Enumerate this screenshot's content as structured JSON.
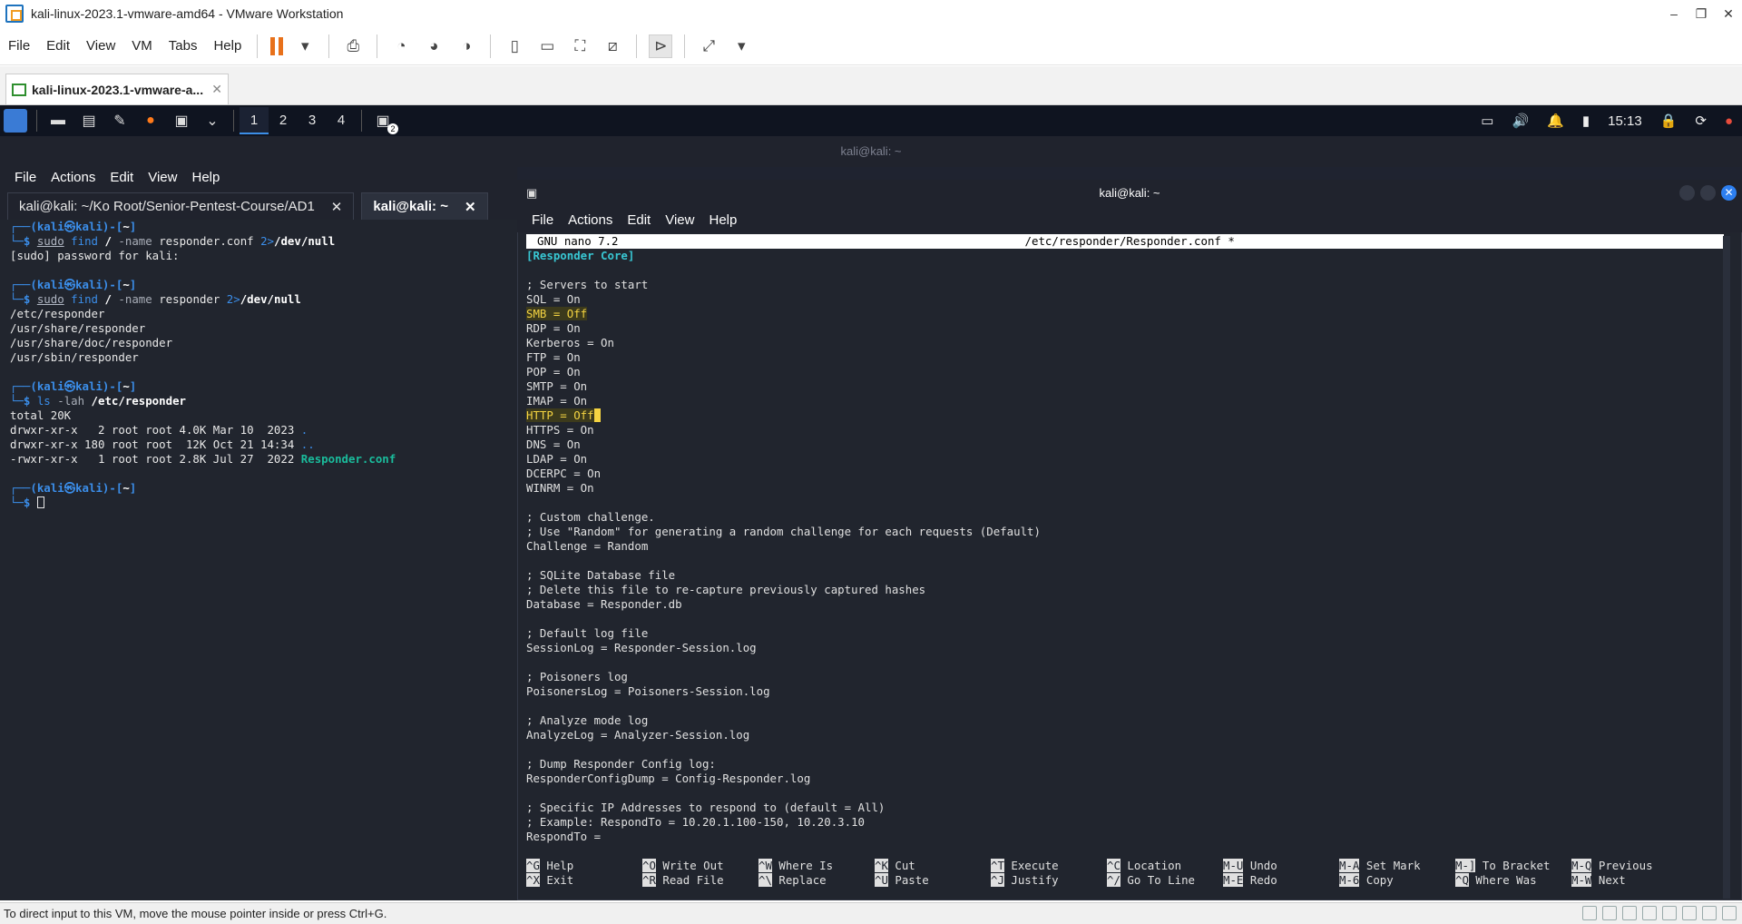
{
  "window": {
    "title": "kali-linux-2023.1-vmware-amd64 - VMware Workstation",
    "controls": [
      "–",
      "❐",
      "✕"
    ]
  },
  "menu": [
    "File",
    "Edit",
    "View",
    "VM",
    "Tabs",
    "Help"
  ],
  "vm_tab": {
    "label": "kali-linux-2023.1-vmware-a...",
    "close": "✕"
  },
  "kali_panel": {
    "workspaces": [
      "1",
      "2",
      "3",
      "4"
    ],
    "clock": "15:13",
    "terminal_badge": "2"
  },
  "term_left": {
    "window_title": "kali@kali: ~",
    "menu": [
      "File",
      "Actions",
      "Edit",
      "View",
      "Help"
    ],
    "tabs": [
      {
        "label": "kali@kali: ~/Ko Root/Senior-Pentest-Course/AD1",
        "close": "✕"
      },
      {
        "label": "kali@kali: ~",
        "close": "✕"
      }
    ],
    "prompt_user": "kali",
    "prompt_host": "kali",
    "prompt_dir": "~",
    "cmd1": {
      "sudo": "sudo",
      "find": "find",
      "slash": "/",
      "opt": "-name",
      "arg": "responder.conf",
      "redir": "2>",
      "devnull": "/dev/null"
    },
    "out1": [
      "[sudo] password for kali:"
    ],
    "cmd2": {
      "sudo": "sudo",
      "find": "find",
      "slash": "/",
      "opt": "-name",
      "arg": "responder",
      "redir": "2>",
      "devnull": "/dev/null"
    },
    "out2": [
      "/etc/responder",
      "/usr/share/responder",
      "/usr/share/doc/responder",
      "/usr/sbin/responder"
    ],
    "cmd3": {
      "ls": "ls",
      "opt": "-lah",
      "arg": "/etc/responder"
    },
    "out3": {
      "total": "total 20K",
      "rows": [
        {
          "meta": "drwxr-xr-x   2 root root 4.0K Mar 10  2023 ",
          "name": "."
        },
        {
          "meta": "drwxr-xr-x 180 root root  12K Oct 21 14:34 ",
          "name": ".."
        },
        {
          "meta": "-rwxr-xr-x   1 root root 2.8K Jul 27  2022 ",
          "name": "Responder.conf"
        }
      ]
    }
  },
  "term_right": {
    "window_title": "kali@kali: ~",
    "menu": [
      "File",
      "Actions",
      "Edit",
      "View",
      "Help"
    ],
    "nano_version": "GNU nano 7.2",
    "nano_file": "/etc/responder/Responder.conf *",
    "lines": [
      "[Responder Core]",
      "",
      "; Servers to start",
      "SQL = On",
      "SMB = Off",
      "RDP = On",
      "Kerberos = On",
      "FTP = On",
      "POP = On",
      "SMTP = On",
      "IMAP = On",
      "HTTP = Off",
      "HTTPS = On",
      "DNS = On",
      "LDAP = On",
      "DCERPC = On",
      "WINRM = On",
      "",
      "; Custom challenge.",
      "; Use \"Random\" for generating a random challenge for each requests (Default)",
      "Challenge = Random",
      "",
      "; SQLite Database file",
      "; Delete this file to re-capture previously captured hashes",
      "Database = Responder.db",
      "",
      "; Default log file",
      "SessionLog = Responder-Session.log",
      "",
      "; Poisoners log",
      "PoisonersLog = Poisoners-Session.log",
      "",
      "; Analyze mode log",
      "AnalyzeLog = Analyzer-Session.log",
      "",
      "; Dump Responder Config log:",
      "ResponderConfigDump = Config-Responder.log",
      "",
      "; Specific IP Addresses to respond to (default = All)",
      "; Example: RespondTo = 10.20.1.100-150, 10.20.3.10",
      "RespondTo ="
    ],
    "shortcuts_row1": [
      {
        "key": "^G",
        "label": "Help"
      },
      {
        "key": "^O",
        "label": "Write Out"
      },
      {
        "key": "^W",
        "label": "Where Is"
      },
      {
        "key": "^K",
        "label": "Cut"
      },
      {
        "key": "^T",
        "label": "Execute"
      },
      {
        "key": "^C",
        "label": "Location"
      },
      {
        "key": "M-U",
        "label": "Undo"
      },
      {
        "key": "M-A",
        "label": "Set Mark"
      },
      {
        "key": "M-]",
        "label": "To Bracket"
      },
      {
        "key": "M-Q",
        "label": "Previous"
      }
    ],
    "shortcuts_row2": [
      {
        "key": "^X",
        "label": "Exit"
      },
      {
        "key": "^R",
        "label": "Read File"
      },
      {
        "key": "^\\",
        "label": "Replace"
      },
      {
        "key": "^U",
        "label": "Paste"
      },
      {
        "key": "^J",
        "label": "Justify"
      },
      {
        "key": "^/",
        "label": "Go To Line"
      },
      {
        "key": "M-E",
        "label": "Redo"
      },
      {
        "key": "M-6",
        "label": "Copy"
      },
      {
        "key": "^Q",
        "label": "Where Was"
      },
      {
        "key": "M-W",
        "label": "Next"
      }
    ]
  },
  "status_bar": {
    "text": "To direct input to this VM, move the mouse pointer inside or press Ctrl+G."
  },
  "colors": {
    "accent": "#3b8eea",
    "highlight": "#f5d442",
    "header": "#38c7d3",
    "terminal_bg": "#21252e"
  }
}
